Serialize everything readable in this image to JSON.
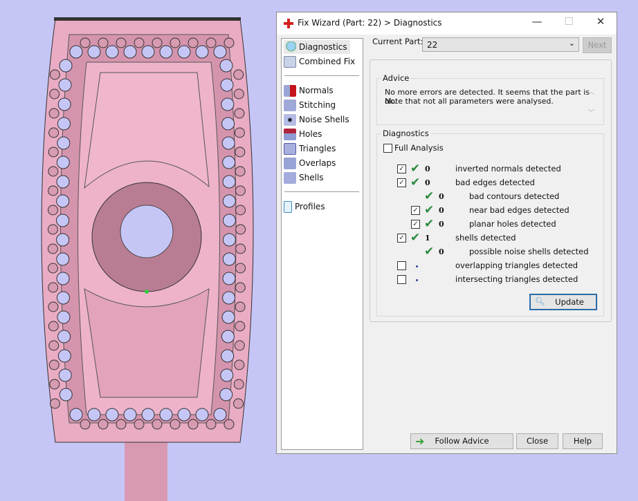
{
  "dialog": {
    "title": "Fix Wizard (Part: 22) > Diagnostics",
    "minimize": "—",
    "maximize": "☐",
    "close": "✕"
  },
  "tree": {
    "top": [
      {
        "label": "Diagnostics",
        "icon": "magnifier-icon"
      },
      {
        "label": "Combined Fix",
        "icon": "combined-fix-icon"
      }
    ],
    "fixes": [
      {
        "label": "Normals",
        "icon": "normals-icon"
      },
      {
        "label": "Stitching",
        "icon": "stitching-icon"
      },
      {
        "label": "Noise Shells",
        "icon": "noise-shells-icon"
      },
      {
        "label": "Holes",
        "icon": "holes-icon"
      },
      {
        "label": "Triangles",
        "icon": "triangles-icon"
      },
      {
        "label": "Overlaps",
        "icon": "overlaps-icon"
      },
      {
        "label": "Shells",
        "icon": "shells-icon"
      }
    ],
    "profiles": {
      "label": "Profiles",
      "icon": "document-icon"
    }
  },
  "current_part": {
    "label": "Current Part:",
    "value": "22",
    "next": "Next"
  },
  "advice": {
    "title": "Advice",
    "line1": "No more errors are detected. It seems that the part is ok.",
    "line2": "Note that not all parameters were analysed."
  },
  "diagnostics": {
    "title": "Diagnostics",
    "full_analysis": "Full Analysis",
    "update": "Update",
    "rows": [
      {
        "checkbox": true,
        "checked": true,
        "status": "ok",
        "count": "0",
        "label": "inverted normals detected",
        "level": 0
      },
      {
        "checkbox": true,
        "checked": true,
        "status": "ok",
        "count": "0",
        "label": "bad edges detected",
        "level": 0
      },
      {
        "checkbox": false,
        "checked": false,
        "status": "ok",
        "count": "0",
        "label": "bad contours detected",
        "level": 1
      },
      {
        "checkbox": true,
        "checked": true,
        "status": "ok",
        "count": "0",
        "label": "near bad edges detected",
        "level": 1
      },
      {
        "checkbox": true,
        "checked": true,
        "status": "ok",
        "count": "0",
        "label": "planar holes detected",
        "level": 1
      },
      {
        "checkbox": true,
        "checked": true,
        "status": "ok",
        "count": "1",
        "label": "shells detected",
        "level": 0
      },
      {
        "checkbox": false,
        "checked": false,
        "status": "ok",
        "count": "0",
        "label": "possible noise shells detected",
        "level": 1
      },
      {
        "checkbox": true,
        "checked": false,
        "status": "pending",
        "count": "",
        "label": "overlapping triangles detected",
        "level": 0
      },
      {
        "checkbox": true,
        "checked": false,
        "status": "pending",
        "count": "",
        "label": "intersecting triangles detected",
        "level": 0
      }
    ]
  },
  "buttons": {
    "follow_advice": "Follow Advice",
    "close": "Close",
    "help": "Help"
  },
  "colors": {
    "background": "#c6c6f6",
    "part": "#e8aac2",
    "accent": "#2b8a3e"
  }
}
